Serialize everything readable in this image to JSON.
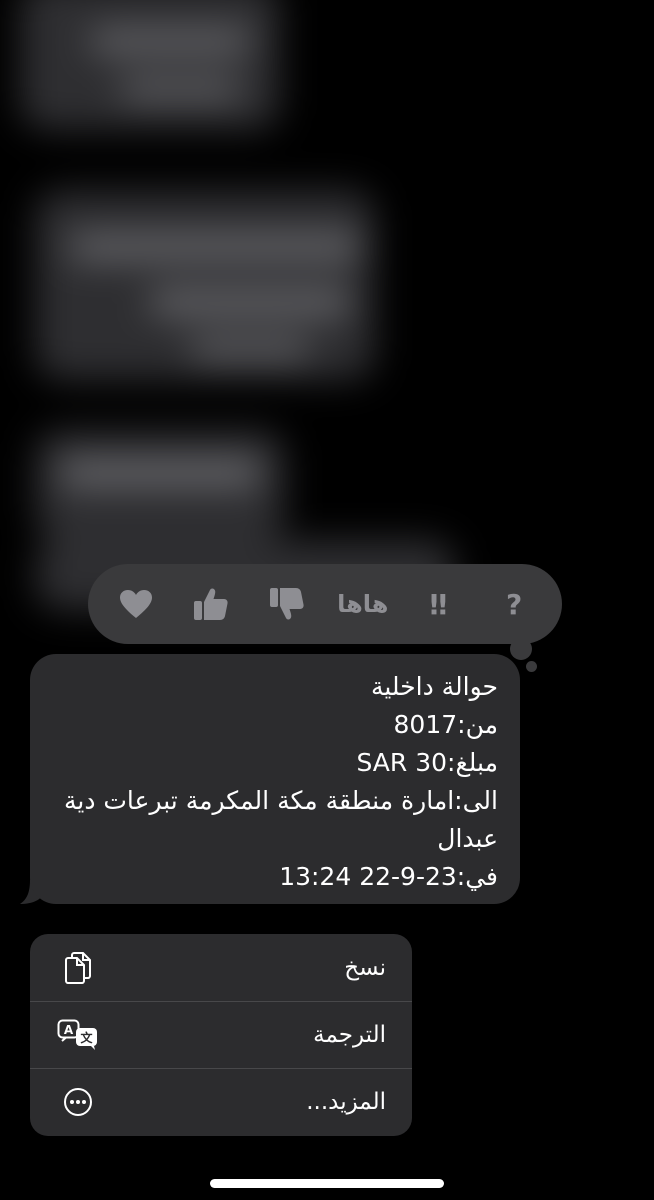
{
  "reactions": {
    "question": "?",
    "exclamation": "‼",
    "haha": "هاها"
  },
  "message": {
    "lines": [
      "حوالة داخلية",
      "من:8017",
      "مبلغ:30 SAR",
      "الى:امارة منطقة مكة المكرمة تبرعات دية عبدال",
      "في:23-9-22 13:24"
    ]
  },
  "menu": {
    "items": [
      {
        "label": "نسخ",
        "icon": "copy-icon"
      },
      {
        "label": "الترجمة",
        "icon": "translate-icon"
      },
      {
        "label": "المزيد...",
        "icon": "more-icon"
      }
    ]
  },
  "colors": {
    "background": "#000000",
    "bubble": "#2c2c2e",
    "tapback": "#3a3a3c",
    "icon_gray": "#8e8e93",
    "text": "#ffffff"
  }
}
